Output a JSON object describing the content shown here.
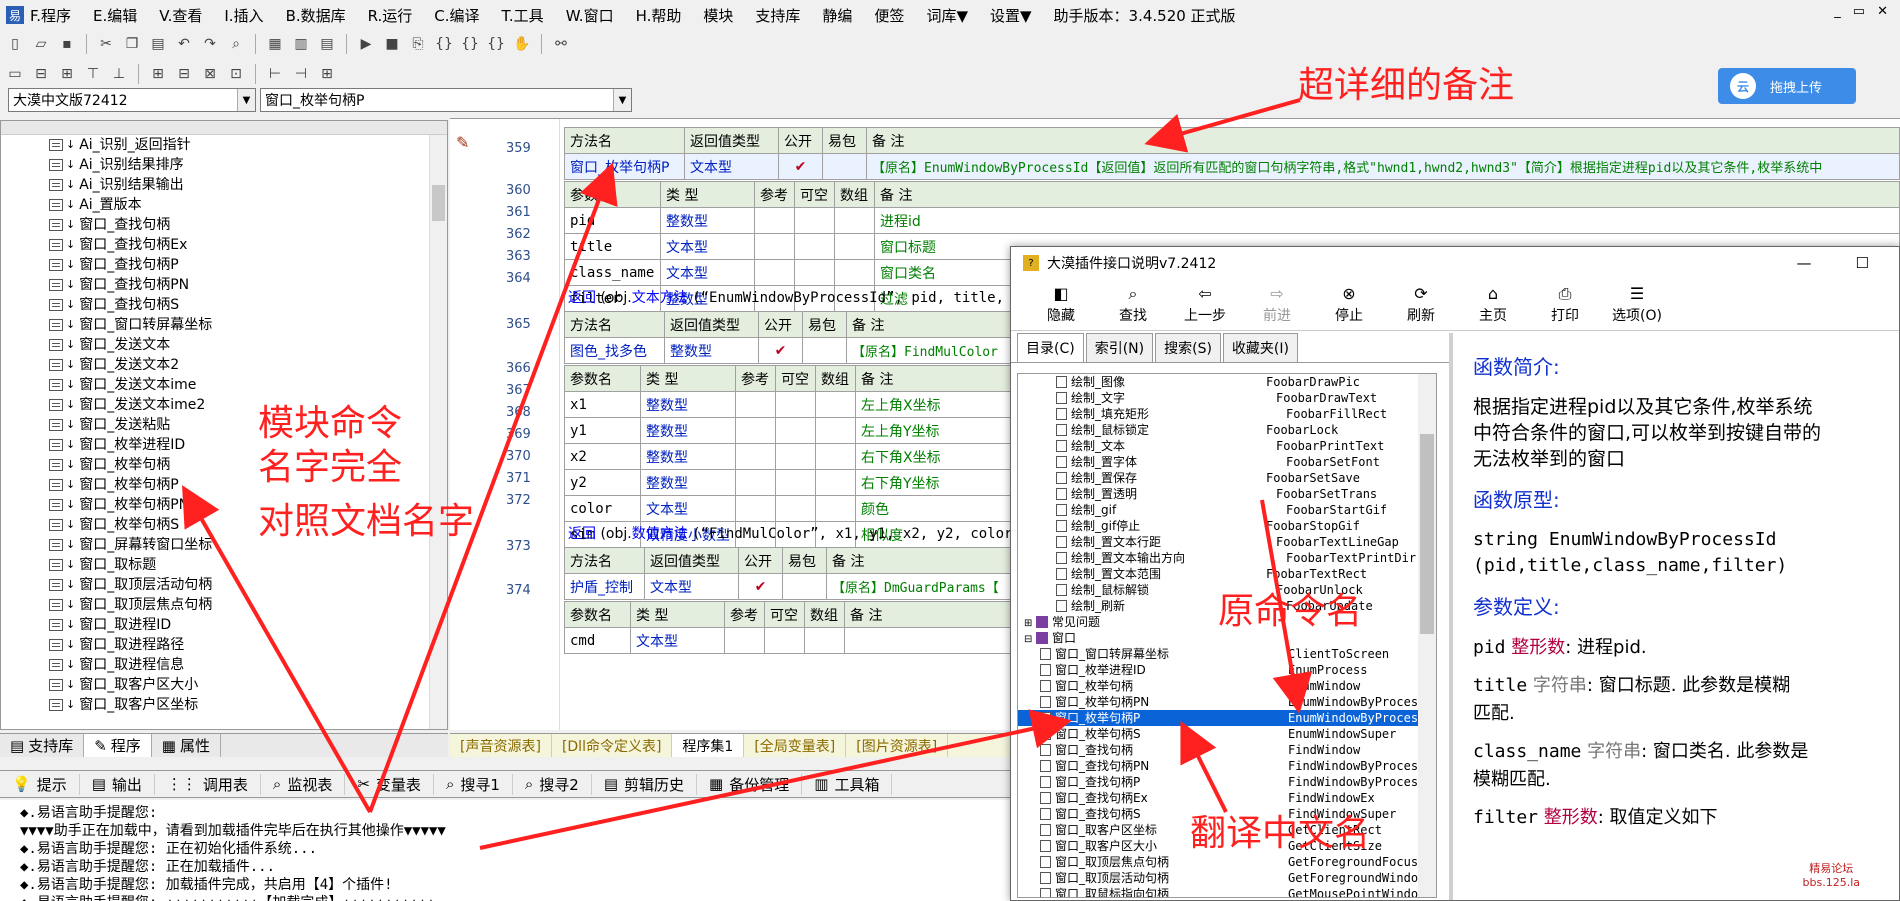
{
  "menubar": {
    "items": [
      "F.程序",
      "E.编辑",
      "V.查看",
      "I.插入",
      "B.数据库",
      "R.运行",
      "C.编译",
      "T.工具",
      "W.窗口",
      "H.帮助",
      "模块",
      "支持库",
      "静编",
      "便签",
      "词库▼",
      "设置▼",
      "助手版本：3.4.520 正式版"
    ]
  },
  "combos": {
    "left": "大漠中文版72412",
    "right": "窗口_枚举句柄P"
  },
  "upload_button": "拖拽上传",
  "tree": {
    "items": [
      "Ai_识别_返回指针",
      "Ai_识别结果排序",
      "Ai_识别结果输出",
      "Ai_置版本",
      "窗口_查找句柄",
      "窗口_查找句柄Ex",
      "窗口_查找句柄P",
      "窗口_查找句柄PN",
      "窗口_查找句柄S",
      "窗口_窗口转屏幕坐标",
      "窗口_发送文本",
      "窗口_发送文本2",
      "窗口_发送文本ime",
      "窗口_发送文本ime2",
      "窗口_发送粘贴",
      "窗口_枚举进程ID",
      "窗口_枚举句柄",
      "窗口_枚举句柄P",
      "窗口_枚举句柄PN",
      "窗口_枚举句柄S",
      "窗口_屏幕转窗口坐标",
      "窗口_取标题",
      "窗口_取顶层活动句柄",
      "窗口_取顶层焦点句柄",
      "窗口_取进程ID",
      "窗口_取进程路径",
      "窗口_取进程信息",
      "窗口_取客户区大小",
      "窗口_取客户区坐标"
    ]
  },
  "left_tabs": [
    "支持库",
    "程序",
    "属性"
  ],
  "code": {
    "line_numbers": [
      "359",
      "360",
      "361",
      "362",
      "363",
      "364",
      "365",
      "366",
      "367",
      "368",
      "369",
      "370",
      "371",
      "372",
      "373",
      "374"
    ],
    "t1_header": [
      "方法名",
      "返回值类型",
      "公开",
      "易包",
      "备 注"
    ],
    "t1_row": [
      "窗口_枚举句柄P",
      "文本型",
      "✔",
      "",
      "【原名】EnumWindowByProcessId【返回值】返回所有匹配的窗口句柄字符串,格式\"hwnd1,hwnd2,hwnd3\"【简介】根据指定进程pid以及其它条件,枚举系统中"
    ],
    "t1_param_header": [
      "参数名",
      "类 型",
      "参考",
      "可空",
      "数组",
      "备 注"
    ],
    "t1_params": [
      [
        "pid",
        "整数型",
        "进程id"
      ],
      [
        "title",
        "文本型",
        "窗口标题"
      ],
      [
        "class_name",
        "文本型",
        "窗口类名"
      ],
      [
        "filter",
        "整数型",
        "过滤"
      ]
    ],
    "line364": [
      "返回",
      "(obj.",
      "文本方法",
      "(“EnumWindowByProcessId”, pid, title,"
    ],
    "t2_header": [
      "方法名",
      "返回值类型",
      "公开",
      "易包",
      "备 注"
    ],
    "t2_row": [
      "图色_找多色",
      "整数型",
      "✔",
      "",
      "【原名】FindMulColor"
    ],
    "t2_param_header": [
      "参数名",
      "类 型",
      "参考",
      "可空",
      "数组",
      "备 注"
    ],
    "t2_params": [
      [
        "x1",
        "整数型",
        "左上角X坐标"
      ],
      [
        "y1",
        "整数型",
        "左上角Y坐标"
      ],
      [
        "x2",
        "整数型",
        "右下角X坐标"
      ],
      [
        "y2",
        "整数型",
        "右下角Y坐标"
      ],
      [
        "color",
        "文本型",
        "颜色"
      ],
      [
        "sim",
        "双精度小数型",
        "相似度"
      ]
    ],
    "line372": [
      "返回",
      "(obj.",
      "数值方法",
      "(“FindMulColor”, x1, y1, x2, y2, color"
    ],
    "t3_header": [
      "方法名",
      "返回值类型",
      "公开",
      "易包",
      "备 注"
    ],
    "t3_row": [
      "护盾_控制",
      "文本型",
      "✔",
      "",
      "【原名】DmGuardParams【"
    ],
    "t3_param_header": [
      "参数名",
      "类 型",
      "参考",
      "可空",
      "数组",
      "备 注"
    ],
    "t3_params": [
      [
        "cmd",
        "文本型",
        ""
      ]
    ]
  },
  "code_tabs": [
    "[声音资源表]",
    "[Dll命令定义表]",
    "程序集1",
    "[全局变量表]",
    "[图片资源表]"
  ],
  "bottom_tabs": [
    "提示",
    "输出",
    "调用表",
    "监视表",
    "变量表",
    "搜寻1",
    "搜寻2",
    "剪辑历史",
    "备份管理",
    "工具箱"
  ],
  "output": [
    "◆.易语言助手提醒您:",
    "▼▼▼▼助手正在加载中，请看到加载插件完毕后在执行其他操作▼▼▼▼▼",
    "◆.易语言助手提醒您: 正在初始化插件系统...",
    "◆.易语言助手提醒您: 正在加载插件...",
    "◆.易语言助手提醒您: 加载插件完成，共启用【4】个插件!",
    "◆.易语言助手提醒您: ▲▲▲▲▲▲▲▲▲▲▲【加载完成】▲▲▲▲▲▲▲▲▲▲▲"
  ],
  "help": {
    "title": "大漠插件接口说明v7.2412",
    "toolbar": [
      {
        "label": "隐藏",
        "icon": "hide-icon",
        "disabled": false
      },
      {
        "label": "查找",
        "icon": "find-icon",
        "disabled": false
      },
      {
        "label": "上一步",
        "icon": "back-icon",
        "disabled": false
      },
      {
        "label": "前进",
        "icon": "forward-icon",
        "disabled": true
      },
      {
        "label": "停止",
        "icon": "stop-icon",
        "disabled": false
      },
      {
        "label": "刷新",
        "icon": "refresh-icon",
        "disabled": false
      },
      {
        "label": "主页",
        "icon": "home-icon",
        "disabled": false
      },
      {
        "label": "打印",
        "icon": "print-icon",
        "disabled": false
      },
      {
        "label": "选项(O)",
        "icon": "options-icon",
        "disabled": false
      }
    ],
    "tabs": [
      "目录(C)",
      "索引(N)",
      "搜索(S)",
      "收藏夹(I)"
    ],
    "tree": [
      [
        "绘制_图像",
        "FoobarDrawPic"
      ],
      [
        "绘制_文字",
        "FoobarDrawText"
      ],
      [
        "绘制_填充矩形",
        "FoobarFillRect"
      ],
      [
        "绘制_鼠标锁定",
        "FoobarLock"
      ],
      [
        "绘制_文本",
        "FoobarPrintText"
      ],
      [
        "绘制_置字体",
        "FoobarSetFont"
      ],
      [
        "绘制_置保存",
        "FoobarSetSave"
      ],
      [
        "绘制_置透明",
        "FoobarSetTrans"
      ],
      [
        "绘制_gif",
        "FoobarStartGif"
      ],
      [
        "绘制_gif停止",
        "FoobarStopGif"
      ],
      [
        "绘制_置文本行距",
        "FoobarTextLineGap"
      ],
      [
        "绘制_置文本输出方向",
        "FoobarTextPrintDir"
      ],
      [
        "绘制_置文本范围",
        "FoobarTextRect"
      ],
      [
        "绘制_鼠标解锁",
        "FoobarUnlock"
      ],
      [
        "绘制_刷新",
        "FoobarUpdate"
      ],
      [
        "常见问题",
        ""
      ],
      [
        "窗口",
        ""
      ],
      [
        "窗口_窗口转屏幕坐标",
        "ClientToScreen"
      ],
      [
        "窗口_枚举进程ID",
        "EnumProcess"
      ],
      [
        "窗口_枚举句柄",
        "EnumWindow"
      ],
      [
        "窗口_枚举句柄PN",
        "EnumWindowByProcess"
      ],
      [
        "窗口_枚举句柄P",
        "EnumWindowByProcessId"
      ],
      [
        "窗口_枚举句柄S",
        "EnumWindowSuper"
      ],
      [
        "窗口_查找句柄",
        "FindWindow"
      ],
      [
        "窗口_查找句柄PN",
        "FindWindowByProcess"
      ],
      [
        "窗口_查找句柄P",
        "FindWindowByProcessId"
      ],
      [
        "窗口_查找句柄Ex",
        "FindWindowEx"
      ],
      [
        "窗口_查找句柄S",
        "FindWindowSuper"
      ],
      [
        "窗口_取客户区坐标",
        "GetClientRect"
      ],
      [
        "窗口_取客户区大小",
        "GetClientSize"
      ],
      [
        "窗口_取顶层焦点句柄",
        "GetForegroundFocus"
      ],
      [
        "窗口_取顶层活动句柄",
        "GetForegroundWindow"
      ],
      [
        "窗口_取鼠标指向句柄",
        "GetMousePointWindow"
      ]
    ],
    "content": {
      "h1": "函数简介:",
      "intro": [
        "根据指定进程pid以及其它条件,枚举系统",
        "中符合条件的窗口,可以枚举到按键自带的",
        "无法枚举到的窗口"
      ],
      "h2": "函数原型:",
      "proto": [
        "string EnumWindowByProcessId",
        "(pid,title,class_name,filter)"
      ],
      "h3": "参数定义:",
      "params": [
        {
          "name": "pid",
          "type": "整形数",
          "desc": ": 进程pid."
        },
        {
          "name": "title",
          "type": "字符串",
          "desc": ": 窗口标题. 此参数是模糊",
          "desc2": "匹配."
        },
        {
          "name": "class_name",
          "type": "字符串",
          "desc": ": 窗口类名. 此参数是",
          "desc2": "模糊匹配."
        },
        {
          "name": "filter",
          "type": "整形数",
          "desc": ": 取值定义如下"
        }
      ]
    }
  },
  "annotations": {
    "a1": "超详细的备注",
    "a2": [
      "模块命令",
      "名字完全",
      "对照文档名字"
    ],
    "a3": "原命令名",
    "a4": "翻译中文名"
  },
  "watermark": [
    "精易论坛",
    "bbs.125.la"
  ]
}
